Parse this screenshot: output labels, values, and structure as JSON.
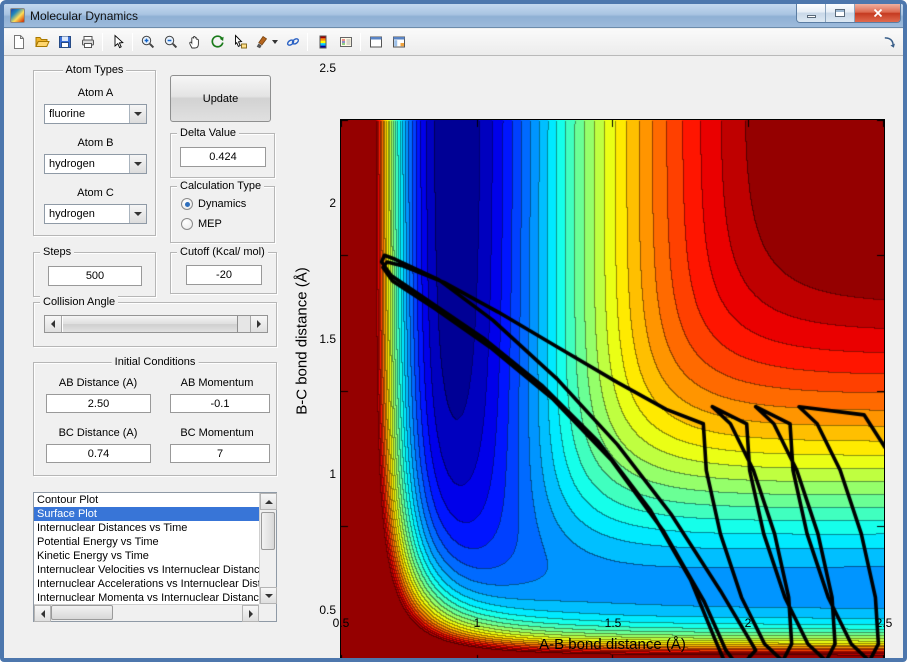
{
  "window": {
    "title": "Molecular Dynamics"
  },
  "toolbar": {
    "buttons": [
      {
        "name": "new-figure"
      },
      {
        "name": "open-file"
      },
      {
        "name": "save-figure"
      },
      {
        "name": "print-figure"
      },
      {
        "name": "edit-plot"
      },
      {
        "name": "zoom-in"
      },
      {
        "name": "zoom-out"
      },
      {
        "name": "pan"
      },
      {
        "name": "rotate-3d"
      },
      {
        "name": "data-cursor"
      },
      {
        "name": "brush-data"
      },
      {
        "name": "link-plot"
      },
      {
        "name": "insert-colorbar"
      },
      {
        "name": "insert-legend"
      },
      {
        "name": "hide-plot-tools"
      },
      {
        "name": "show-plot-tools"
      },
      {
        "name": "dock-figure"
      }
    ]
  },
  "controls": {
    "atom_types": {
      "title": "Atom Types",
      "fields": [
        {
          "label": "Atom A",
          "value": "fluorine"
        },
        {
          "label": "Atom B",
          "value": "hydrogen"
        },
        {
          "label": "Atom C",
          "value": "hydrogen"
        }
      ]
    },
    "update": {
      "label": "Update"
    },
    "delta": {
      "title": "Delta Value",
      "value": "0.424"
    },
    "calculation_type": {
      "title": "Calculation Type",
      "options": [
        {
          "label": "Dynamics",
          "selected": true
        },
        {
          "label": "MEP",
          "selected": false
        }
      ]
    },
    "steps": {
      "title": "Steps",
      "value": "500"
    },
    "cutoff": {
      "title": "Cutoff (Kcal/ mol)",
      "value": "-20"
    },
    "collision_angle": {
      "title": "Collision Angle"
    },
    "initial_conditions": {
      "title": "Initial Conditions",
      "fields": [
        {
          "label": "AB Distance (A)",
          "value": "2.50"
        },
        {
          "label": "AB Momentum",
          "value": "-0.1"
        },
        {
          "label": "BC Distance (A)",
          "value": "0.74"
        },
        {
          "label": "BC Momentum",
          "value": "7"
        }
      ]
    },
    "plot_list": {
      "selected_index": 1,
      "selection_color": "#3875d7",
      "items": [
        "Contour Plot",
        "Surface Plot",
        "Internuclear Distances vs Time",
        "Potential Energy vs Time",
        "Kinetic Energy vs Time",
        "Internuclear Velocities vs Internuclear Distance",
        "Internuclear Accelerations vs Internuclear Distance",
        "Internuclear Momenta vs Internuclear Distance"
      ]
    }
  },
  "chart_data": {
    "type": "heatmap",
    "title": "",
    "xlabel": "A-B bond distance (Å)",
    "ylabel": "B-C bond distance (Å)",
    "xlim": [
      0.5,
      2.5
    ],
    "ylim": [
      0.5,
      2.5
    ],
    "xticks": [
      "0.5",
      "1",
      "1.5",
      "2",
      "2.5"
    ],
    "yticks": [
      "0.5",
      "1",
      "1.5",
      "2",
      "2.5"
    ],
    "colormap": "jet",
    "levels": 24,
    "vmin": -140,
    "vmax": -20,
    "cutoff_kcal_mol": -20,
    "surface": "LEPS potential energy surface, collinear F + H2, clipped at cutoff",
    "trajectory": {
      "color": "#000000",
      "width": 3.6,
      "points": [
        [
          2.52,
          1.27
        ],
        [
          2.43,
          1.41
        ],
        [
          2.19,
          1.44
        ],
        [
          2.257,
          1.377
        ],
        [
          2.342,
          1.205
        ],
        [
          2.42,
          0.97
        ],
        [
          2.472,
          0.735
        ],
        [
          2.483,
          0.563
        ],
        [
          2.45,
          0.5
        ],
        [
          2.383,
          0.563
        ],
        [
          2.298,
          0.735
        ],
        [
          2.22,
          0.97
        ],
        [
          2.168,
          1.205
        ],
        [
          2.157,
          1.377
        ],
        [
          2.03,
          1.44
        ],
        [
          2.097,
          1.377
        ],
        [
          2.182,
          1.205
        ],
        [
          2.26,
          0.97
        ],
        [
          2.312,
          0.735
        ],
        [
          2.323,
          0.563
        ],
        [
          2.29,
          0.5
        ],
        [
          2.223,
          0.563
        ],
        [
          2.138,
          0.735
        ],
        [
          2.06,
          0.97
        ],
        [
          2.008,
          1.205
        ],
        [
          1.997,
          1.377
        ],
        [
          1.87,
          1.44
        ],
        [
          1.937,
          1.377
        ],
        [
          2.022,
          1.205
        ],
        [
          2.1,
          0.97
        ],
        [
          2.152,
          0.735
        ],
        [
          2.163,
          0.563
        ],
        [
          2.13,
          0.5
        ],
        [
          2.063,
          0.563
        ],
        [
          1.978,
          0.735
        ],
        [
          1.9,
          0.97
        ],
        [
          1.848,
          1.205
        ],
        [
          1.837,
          1.377
        ],
        [
          1.7,
          1.43
        ],
        [
          1.52,
          1.53
        ],
        [
          1.3,
          1.66
        ],
        [
          1.08,
          1.79
        ],
        [
          0.88,
          1.9
        ],
        [
          0.73,
          1.96
        ],
        [
          0.67,
          1.975
        ],
        [
          0.655,
          1.955
        ],
        [
          0.69,
          1.905
        ],
        [
          0.85,
          1.8
        ],
        [
          1.05,
          1.66
        ],
        [
          1.28,
          1.47
        ],
        [
          1.5,
          1.24
        ],
        [
          1.69,
          0.98
        ],
        [
          1.84,
          0.72
        ],
        [
          1.92,
          0.54
        ],
        [
          1.95,
          0.5
        ],
        [
          1.99,
          0.495
        ],
        [
          2.03,
          0.54
        ],
        [
          1.9,
          0.76
        ],
        [
          1.72,
          1.04
        ],
        [
          1.52,
          1.3
        ],
        [
          1.3,
          1.54
        ],
        [
          1.06,
          1.76
        ],
        [
          0.86,
          1.91
        ],
        [
          0.7,
          1.985
        ],
        [
          0.66,
          2.0
        ],
        [
          0.65,
          1.975
        ],
        [
          0.685,
          1.925
        ],
        [
          0.84,
          1.82
        ],
        [
          1.03,
          1.69
        ],
        [
          1.24,
          1.52
        ],
        [
          1.45,
          1.31
        ],
        [
          1.64,
          1.06
        ],
        [
          1.79,
          0.8
        ],
        [
          1.88,
          0.58
        ],
        [
          1.91,
          0.51
        ]
      ]
    }
  }
}
